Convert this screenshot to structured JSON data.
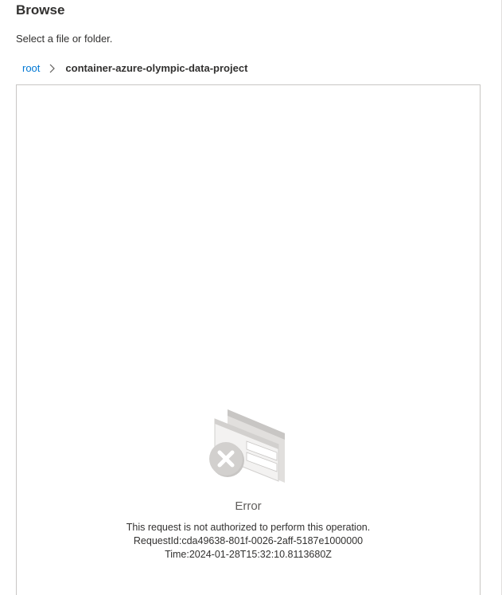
{
  "header": {
    "title": "Browse",
    "subtitle": "Select a file or folder."
  },
  "breadcrumb": {
    "items": [
      {
        "label": "root"
      },
      {
        "label": "container-azure-olympic-data-project"
      }
    ],
    "separator_icon": "chevron-right-icon"
  },
  "error": {
    "icon": "error-card-icon",
    "title": "Error",
    "message": "This request is not authorized to perform this operation.",
    "request_id": "RequestId:cda49638-801f-0026-2aff-5187e1000000",
    "time": "Time:2024-01-28T15:32:10.8113680Z"
  },
  "colors": {
    "link": "#0078d4",
    "border": "#c8c6c4",
    "text": "#323130",
    "muted": "#605e5c"
  }
}
